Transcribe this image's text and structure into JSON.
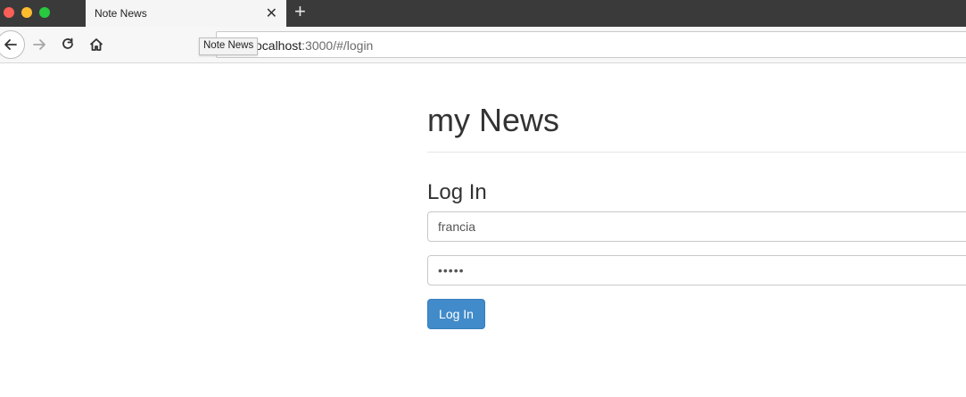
{
  "browser": {
    "tab_title": "Note News",
    "tab_close": "✕",
    "new_tab": "+",
    "url_prefix": "ocalhost",
    "url_rest": ":3000/#/login",
    "tooltip": "Note News"
  },
  "app": {
    "title": "my News"
  },
  "login": {
    "heading": "Log In",
    "username_value": "francia",
    "password_value": "•••••",
    "button_label": "Log In"
  },
  "colors": {
    "button_primary": "#428bca",
    "tab_strip": "#3a3a3a"
  }
}
